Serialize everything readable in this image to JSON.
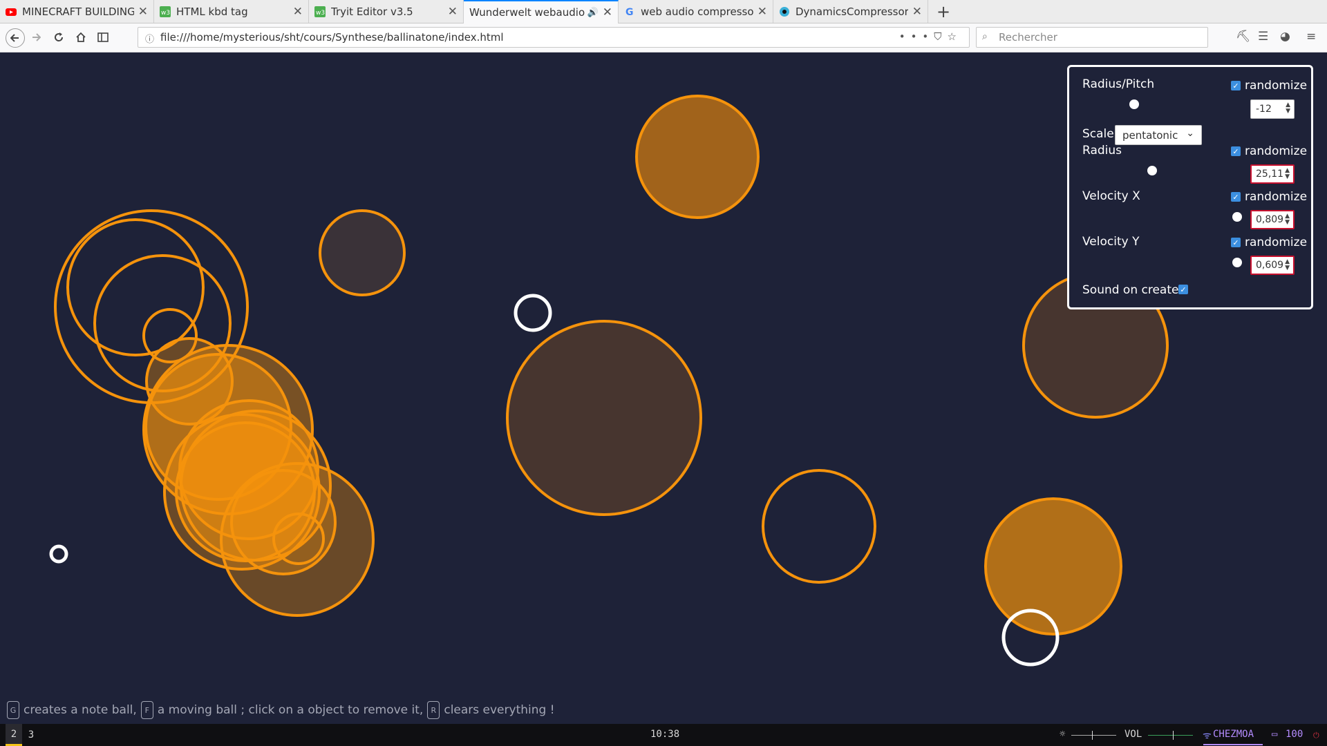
{
  "browser": {
    "tabs": [
      {
        "title": "MINECRAFT BUILDING W",
        "icon": "youtube-icon",
        "color": "#ff0000",
        "active": false
      },
      {
        "title": "HTML kbd tag",
        "icon": "w3schools-icon",
        "color": "#4caf50",
        "active": false
      },
      {
        "title": "Tryit Editor v3.5",
        "icon": "w3schools-icon",
        "color": "#4caf50",
        "active": false
      },
      {
        "title": "Wunderwelt webaudio sy",
        "icon": "",
        "color": "",
        "active": true
      },
      {
        "title": "web audio compressor",
        "icon": "google-icon",
        "color": "#4285f4",
        "active": false
      },
      {
        "title": "DynamicsCompressorN",
        "icon": "mdn-icon",
        "color": "#3ab0d8",
        "active": false
      }
    ],
    "url": "file:///home/mysterious/sht/cours/Synthese/ballinatone/index.html",
    "search_placeholder": "Rechercher"
  },
  "panel": {
    "radius_pitch_label": "Radius/Pitch",
    "randomize_label": "randomize",
    "pitch_value": "-12",
    "pitch_randomize": true,
    "scale_label": "Scale",
    "scale_value": "pentatonic",
    "radius_label": "Radius",
    "radius_value": "25,11",
    "radius_randomize": true,
    "velocity_x_label": "Velocity X",
    "velocity_x_value": "0,809",
    "velocity_x_randomize": true,
    "velocity_y_label": "Velocity Y",
    "velocity_y_value": "0,609",
    "velocity_y_randomize": true,
    "sound_on_create_label": "Sound on create",
    "sound_on_create": true
  },
  "hint": {
    "key_g": "G",
    "text_g": "creates a note ball,",
    "key_f": "F",
    "text_f": "a moving ball ; click on a object to remove it,",
    "key_r": "R",
    "text_r": "clears everything !"
  },
  "statusbar": {
    "workspaces": [
      "2",
      "3"
    ],
    "active_workspace": "2",
    "clock": "10:38",
    "vol_label": "VOL",
    "network": "CHEZMOA",
    "battery": "100"
  },
  "colors": {
    "background": "#1e2238",
    "ball_stroke": "#f5930c",
    "ring": "#ffffff",
    "accent_checkbox": "#3c8fe0"
  }
}
